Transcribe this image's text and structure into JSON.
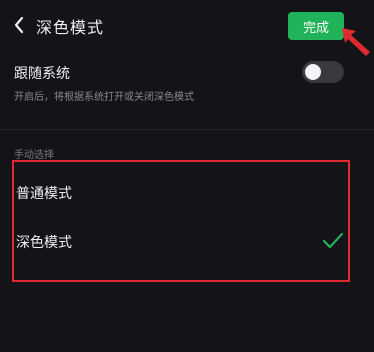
{
  "header": {
    "title": "深色模式",
    "done_label": "完成"
  },
  "follow_system": {
    "label": "跟随系统",
    "description": "开启后，将根据系统打开或关闭深色模式",
    "enabled": false
  },
  "manual_section": {
    "label": "手动选择",
    "options": [
      {
        "label": "普通模式",
        "selected": false
      },
      {
        "label": "深色模式",
        "selected": true
      }
    ]
  },
  "colors": {
    "accent": "#21b359",
    "background": "#141318",
    "annotation": "#e02a2f"
  },
  "icons": {
    "back": "chevron-left-icon",
    "check": "checkmark-icon",
    "annotation": "red-arrow-icon"
  }
}
